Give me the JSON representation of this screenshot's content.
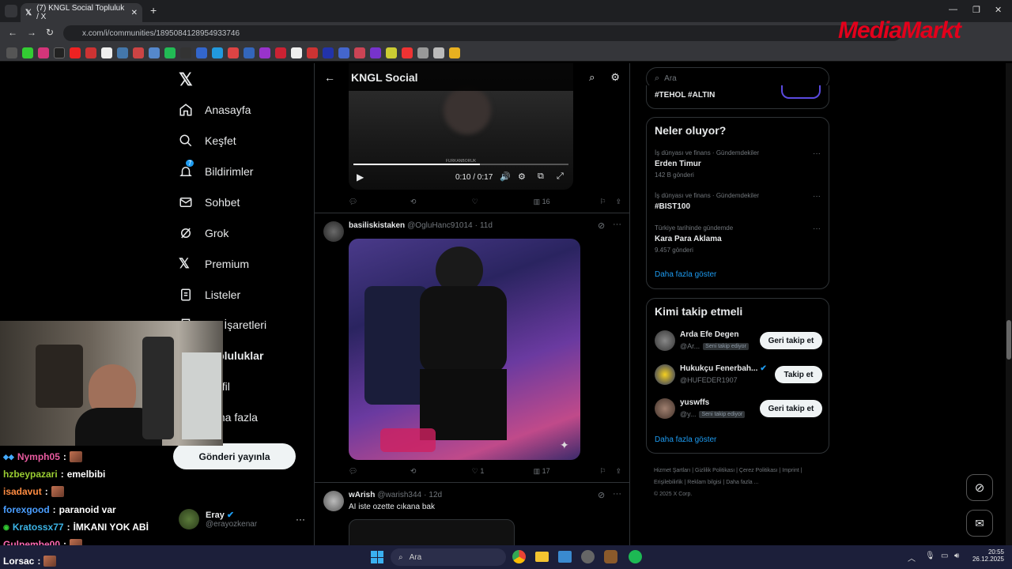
{
  "browser": {
    "tab_title": "(7) KNGL Social Topluluk / X",
    "url": "x.com/i/communities/1895084128954933746",
    "brand_overlay": "MediaMarkt"
  },
  "nav": {
    "items": [
      {
        "label": "Anasayfa",
        "icon": "home-icon"
      },
      {
        "label": "Keşfet",
        "icon": "search-icon"
      },
      {
        "label": "Bildirimler",
        "icon": "bell-icon",
        "badge": "7"
      },
      {
        "label": "Sohbet",
        "icon": "mail-icon"
      },
      {
        "label": "Grok",
        "icon": "grok-icon"
      },
      {
        "label": "Premium",
        "icon": "x-icon"
      },
      {
        "label": "Listeler",
        "icon": "list-icon"
      },
      {
        "label": "Yer İşaretleri",
        "icon": "bookmark-icon"
      },
      {
        "label": "Topluluklar",
        "icon": "people-icon"
      },
      {
        "label": "Profil",
        "icon": "person-icon"
      },
      {
        "label": "Daha fazla",
        "icon": "more-icon"
      }
    ],
    "post_button": "Gönderi yayınla",
    "user": {
      "name": "Eray",
      "handle": "@erayozkenar"
    }
  },
  "feed": {
    "header_title": "KNGL Social",
    "video": {
      "watermark": "FURKANBORUK",
      "time": "0:10 / 0:17",
      "progress": 0.59,
      "views": "16"
    },
    "post1": {
      "name": "basiliskistaken",
      "handle": "@OgluHanc91014",
      "age": "11d",
      "likes": "1",
      "views": "17"
    },
    "post2": {
      "name": "wArish",
      "handle": "@warish344",
      "age": "12d",
      "text": "AI iste ozette cıkana bak"
    }
  },
  "right": {
    "search_placeholder": "Ara",
    "top_tags": "#TEHOL #ALTIN",
    "trends_title": "Neler oluyor?",
    "trends": [
      {
        "category": "İş dünyası ve finans · Gündemdekiler",
        "name": "Erden Timur",
        "count": "142 B gönderi"
      },
      {
        "category": "İş dünyası ve finans · Gündemdekiler",
        "name": "#BIST100",
        "count": ""
      },
      {
        "category": "Türkiye tarihinde gündemde",
        "name": "Kara Para Aklama",
        "count": "9.457 gönderi"
      }
    ],
    "show_more": "Daha fazla göster",
    "follow_title": "Kimi takip etmeli",
    "follow": [
      {
        "name": "Arda Efe Degen",
        "handle": "@Ar...",
        "badge": "Seni takip ediyor",
        "button": "Geri takip et"
      },
      {
        "name": "Hukukçu Fenerbah...",
        "handle": "@HUFEDER1907",
        "badge": "",
        "button": "Takip et"
      },
      {
        "name": "yuswffs",
        "handle": "@y...",
        "badge": "Seni takip ediyor",
        "button": "Geri takip et"
      }
    ],
    "follow_more": "Daha fazla göster",
    "footer_links": [
      "Hizmet Şartları",
      "Gizlilik Politikası",
      "Çerez Politikası",
      "Imprint",
      "Erişilebilirlik",
      "Reklam bilgisi",
      "Daha fazla ..."
    ],
    "copyright": "© 2025 X Corp."
  },
  "chat": [
    {
      "user": "Nymph05",
      "color": "#e85a9f",
      "msg": ""
    },
    {
      "user": "hzbeypazari",
      "color": "#9acd32",
      "msg": "emelbibi"
    },
    {
      "user": "isadavut",
      "color": "#ff8c42",
      "msg": ""
    },
    {
      "user": "forexgood",
      "color": "#4a9eff",
      "msg": "paranoid var"
    },
    {
      "user": "Kratossx77",
      "color": "#3cb4e6",
      "msg": "İMKANI YOK ABİ"
    },
    {
      "user": "Gulpembe00",
      "color": "#ff69b4",
      "msg": ""
    },
    {
      "user": "Lorsac",
      "color": "#ffffff",
      "msg": ""
    }
  ],
  "taskbar": {
    "search": "Ara",
    "time": "20:55",
    "date": "26.12.2025"
  }
}
